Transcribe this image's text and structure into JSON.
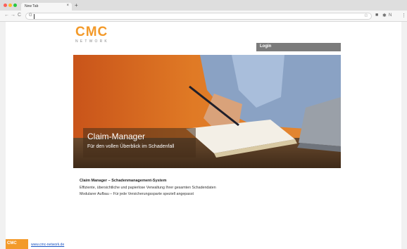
{
  "browser": {
    "tab_title": "New Tab",
    "tab_close": "×",
    "new_tab": "+",
    "nav_back": "←",
    "nav_forward": "→",
    "nav_reload": "C",
    "address_icon": "G",
    "ext_icons": [
      "■",
      "✱",
      "N"
    ],
    "menu": "⋮",
    "star": "☆"
  },
  "logo": {
    "main": "CMC",
    "sub": "NETWORK",
    "brand_color": "#f39a2a"
  },
  "login": {
    "label": "Login"
  },
  "hero": {
    "title": "Claim-Manager",
    "subtitle": "Für den vollen Überblick im Schadenfall"
  },
  "info": {
    "title": "Claim Manager – Schadenmanagement-System",
    "line1": "Effiziente, übersichtliche und papierlose Verwaltung Ihrer gesamten Schadendaten",
    "line2": "Modularer Aufbau – Für jede Versicherungssparte speziell angepasst"
  },
  "footer": {
    "logo_text": "CMC",
    "link": "www.cmc-network.de"
  }
}
